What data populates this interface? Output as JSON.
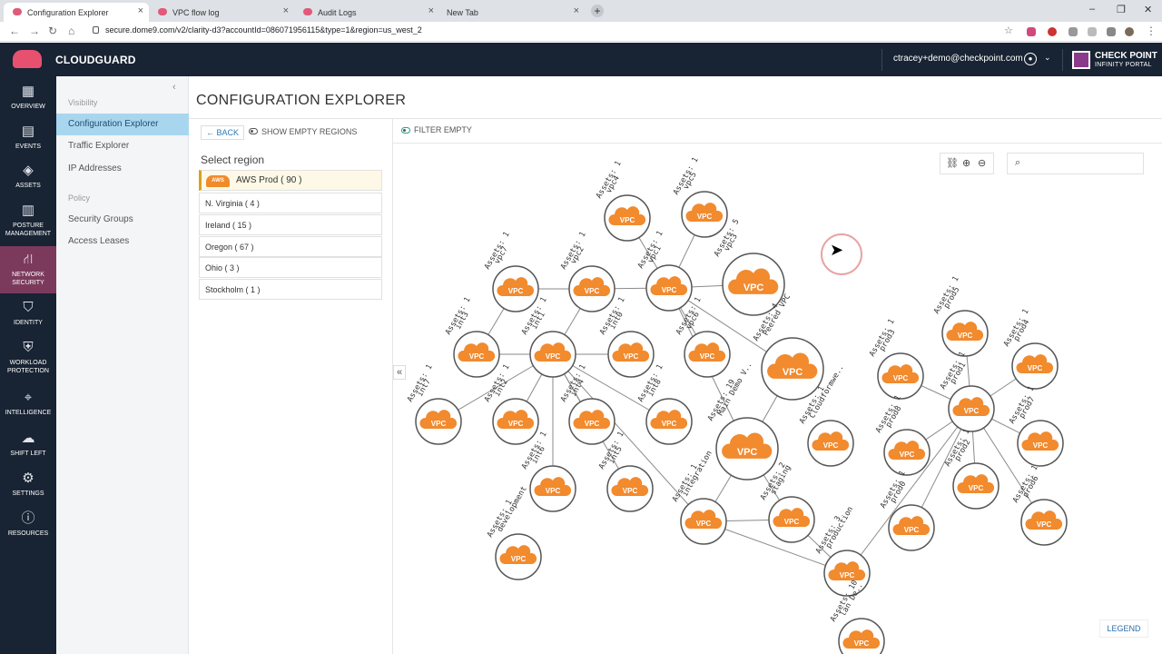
{
  "browser": {
    "tabs": [
      {
        "title": "Configuration Explorer",
        "active": true
      },
      {
        "title": "VPC flow log",
        "active": false
      },
      {
        "title": "Audit Logs",
        "active": false
      },
      {
        "title": "New Tab",
        "active": false
      }
    ],
    "url": "secure.dome9.com/v2/clarity-d3?accountId=086071956115&type=1&region=us_west_2"
  },
  "app": {
    "brand": "CLOUDGUARD",
    "user_email": "ctracey+demo@checkpoint.com",
    "portal_name": "CHECK POINT",
    "portal_sub": "INFINITY PORTAL"
  },
  "leftnav": [
    {
      "label": "OVERVIEW",
      "icon": "grid-icon"
    },
    {
      "label": "EVENTS",
      "icon": "clipboard-icon"
    },
    {
      "label": "ASSETS",
      "icon": "diamond-icon"
    },
    {
      "label": "POSTURE MANAGEMENT",
      "icon": "building-icon"
    },
    {
      "label": "NETWORK SECURITY",
      "icon": "network-icon",
      "active": true
    },
    {
      "label": "IDENTITY",
      "icon": "shield-person-icon"
    },
    {
      "label": "WORKLOAD PROTECTION",
      "icon": "shield-check-icon"
    },
    {
      "label": "INTELLIGENCE",
      "icon": "radar-icon"
    },
    {
      "label": "SHIFT LEFT",
      "icon": "cloud-icon"
    },
    {
      "label": "SETTINGS",
      "icon": "gear-icon"
    },
    {
      "label": "RESOURCES",
      "icon": "help-icon"
    }
  ],
  "subnav": {
    "visibility_header": "Visibility",
    "visibility_items": [
      "Configuration Explorer",
      "Traffic Explorer",
      "IP Addresses"
    ],
    "policy_header": "Policy",
    "policy_items": [
      "Security Groups",
      "Access Leases"
    ]
  },
  "page": {
    "title": "CONFIGURATION EXPLORER",
    "back_label": "BACK",
    "show_empty_label": "SHOW EMPTY REGIONS",
    "filter_empty_label": "FILTER EMPTY",
    "select_region_label": "Select region",
    "legend_label": "LEGEND"
  },
  "regions": [
    {
      "label": "AWS Prod ( 90 )",
      "selected": true,
      "badge": "AWS"
    },
    {
      "label": "N. Virginia ( 4 )"
    },
    {
      "label": "Ireland ( 15 )"
    },
    {
      "label": "Oregon ( 67 )"
    },
    {
      "label": "Ohio ( 3 )"
    },
    {
      "label": "Stockholm ( 1 )"
    }
  ],
  "graph": {
    "node_badge": "VPC",
    "colors": {
      "cloud": "#f28a2e",
      "ring": "#555555",
      "edge": "#8a8a8a",
      "label": "#333333"
    },
    "nodes": [
      {
        "id": "vpc4",
        "name": "vpc4",
        "assets": "Assets: 1"
      },
      {
        "id": "vpc5",
        "name": "vpc5",
        "assets": "Assets: 1"
      },
      {
        "id": "vpc7",
        "name": "vpc7",
        "assets": "Assets: 1"
      },
      {
        "id": "vpc2",
        "name": "vpc2",
        "assets": "Assets: 1"
      },
      {
        "id": "vpc1",
        "name": "vpc1",
        "assets": "Assets: 1"
      },
      {
        "id": "vpc3",
        "name": "vpc3",
        "assets": "Assets: 5"
      },
      {
        "id": "int3",
        "name": "int3",
        "assets": "Assets: 1"
      },
      {
        "id": "int1",
        "name": "int1",
        "assets": "Assets: 1"
      },
      {
        "id": "int0",
        "name": "int0",
        "assets": "Assets: 1"
      },
      {
        "id": "vpc6",
        "name": "vpc6",
        "assets": "Assets: 1"
      },
      {
        "id": "peered",
        "name": "Peered VPC",
        "assets": "Assets: 4"
      },
      {
        "id": "int7",
        "name": "int7",
        "assets": "Assets: 1"
      },
      {
        "id": "int2",
        "name": "int2",
        "assets": "Assets: 1"
      },
      {
        "id": "int4",
        "name": "int4",
        "assets": "Assets: 1"
      },
      {
        "id": "int8",
        "name": "int8",
        "assets": "Assets: 1"
      },
      {
        "id": "maindemo",
        "name": "Main Demo V..",
        "assets": "Assets: 19"
      },
      {
        "id": "cloudform",
        "name": "Cloudformwe..",
        "assets": "Assets: 1"
      },
      {
        "id": "int6",
        "name": "int6",
        "assets": "Assets: 1"
      },
      {
        "id": "int5",
        "name": "int5",
        "assets": "Assets: 1"
      },
      {
        "id": "integration",
        "name": "integration",
        "assets": "Assets: 1"
      },
      {
        "id": "staging",
        "name": "staging",
        "assets": "Assets: 2"
      },
      {
        "id": "development",
        "name": "development",
        "assets": "Assets: 1"
      },
      {
        "id": "production",
        "name": "production",
        "assets": "Assets: 3"
      },
      {
        "id": "prod5",
        "name": "prod5",
        "assets": "Assets: 1"
      },
      {
        "id": "prod3",
        "name": "prod3",
        "assets": "Assets: 1"
      },
      {
        "id": "prod4",
        "name": "prod4",
        "assets": "Assets: 1"
      },
      {
        "id": "prod1",
        "name": "prod1",
        "assets": "Assets: 1"
      },
      {
        "id": "prod8",
        "name": "prod8",
        "assets": "Assets: 1"
      },
      {
        "id": "prod7",
        "name": "prod7",
        "assets": "Assets: 1"
      },
      {
        "id": "prod2",
        "name": "prod2",
        "assets": "Assets: 1"
      },
      {
        "id": "prod0",
        "name": "prod0",
        "assets": "Assets: 1"
      },
      {
        "id": "prod6",
        "name": "prod6",
        "assets": "Assets: 1"
      },
      {
        "id": "bottom",
        "name": "lan De..",
        "assets": "Assets: 10"
      }
    ],
    "edges": [
      [
        "vpc4",
        "vpc1"
      ],
      [
        "vpc5",
        "vpc1"
      ],
      [
        "vpc7",
        "vpc2"
      ],
      [
        "vpc2",
        "vpc1"
      ],
      [
        "vpc1",
        "vpc3"
      ],
      [
        "vpc7",
        "int3"
      ],
      [
        "vpc2",
        "int1"
      ],
      [
        "vpc1",
        "vpc6"
      ],
      [
        "vpc1",
        "peered"
      ],
      [
        "vpc1",
        "maindemo"
      ],
      [
        "int1",
        "int3"
      ],
      [
        "int1",
        "int0"
      ],
      [
        "int1",
        "int7"
      ],
      [
        "int1",
        "int2"
      ],
      [
        "int1",
        "int4"
      ],
      [
        "int1",
        "int8"
      ],
      [
        "int1",
        "int6"
      ],
      [
        "int1",
        "int5"
      ],
      [
        "int1",
        "integration"
      ],
      [
        "peered",
        "maindemo"
      ],
      [
        "maindemo",
        "staging"
      ],
      [
        "maindemo",
        "integration"
      ],
      [
        "integration",
        "staging"
      ],
      [
        "integration",
        "production"
      ],
      [
        "staging",
        "production"
      ],
      [
        "production",
        "prod1"
      ],
      [
        "prod1",
        "prod5"
      ],
      [
        "prod1",
        "prod3"
      ],
      [
        "prod1",
        "prod4"
      ],
      [
        "prod1",
        "prod8"
      ],
      [
        "prod1",
        "prod7"
      ],
      [
        "prod1",
        "prod2"
      ],
      [
        "prod1",
        "prod0"
      ],
      [
        "prod1",
        "prod6"
      ]
    ]
  }
}
